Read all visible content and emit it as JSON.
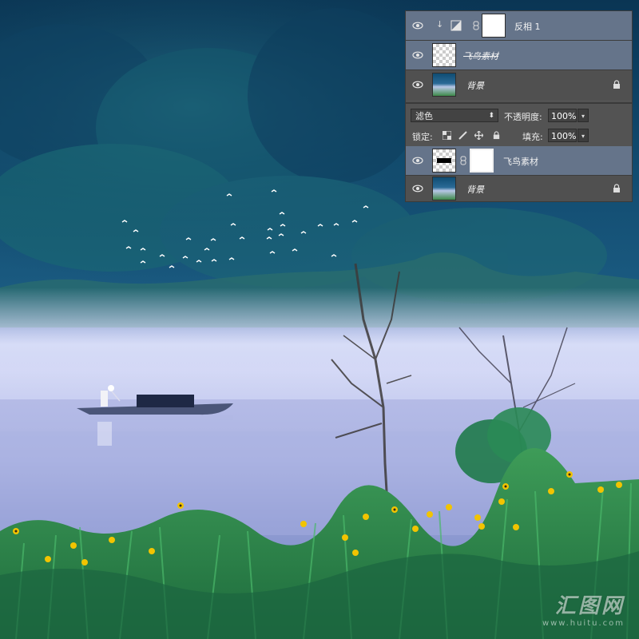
{
  "top_panel": {
    "layers": [
      {
        "name": "反相 1",
        "type": "adjustment",
        "selected": true
      },
      {
        "name": "飞鸟素材",
        "type": "pixel",
        "selected": true
      },
      {
        "name": "背景",
        "type": "background",
        "locked": true,
        "selected": false
      }
    ]
  },
  "bottom_panel": {
    "blend_mode": "滤色",
    "opacity_label": "不透明度:",
    "opacity_value": "100%",
    "lock_label": "锁定:",
    "fill_label": "填充:",
    "fill_value": "100%",
    "layers": [
      {
        "name": "飞鸟素材",
        "type": "pixel-with-mask",
        "selected": true
      },
      {
        "name": "背景",
        "type": "background",
        "locked": true,
        "selected": false
      }
    ]
  },
  "watermark": {
    "main": "汇图网",
    "sub": "www.huitu.com"
  },
  "icons": [
    "eye-icon",
    "lock-icon",
    "chain-icon",
    "adjustment-clip-icon",
    "move-icon",
    "brush-icon",
    "transparency-lock-icon"
  ],
  "colors": {
    "panel_bg": "#535353",
    "selected_row": "#65748a",
    "sky_top": "#0b3a5c",
    "fog": "#c9d0ee",
    "grass": "#2f8a45"
  }
}
